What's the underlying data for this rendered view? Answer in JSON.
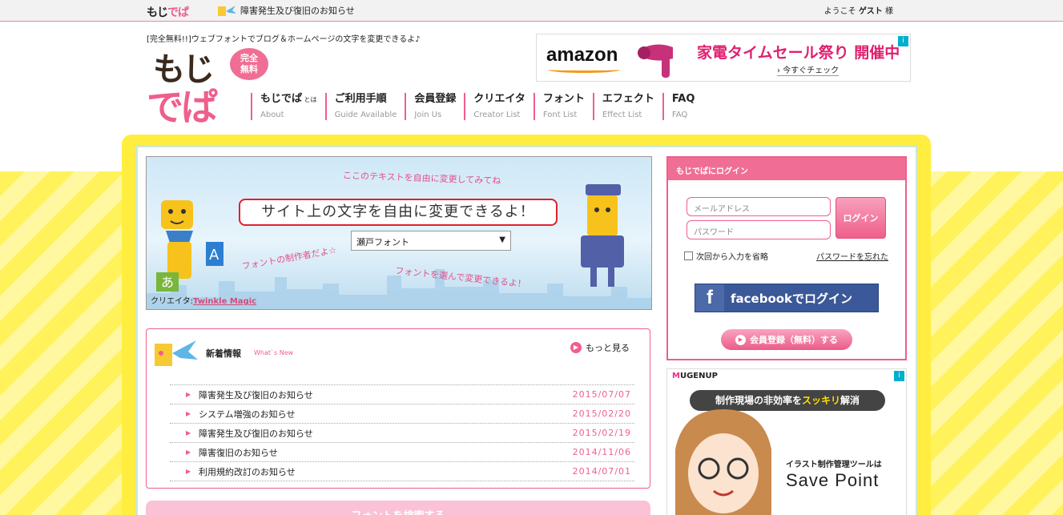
{
  "topbar": {
    "logo_a": "もじ",
    "logo_b": "でぱ",
    "notice": "障害発生及び復旧のお知らせ",
    "welcome_pre": "ようこそ",
    "welcome_name": "ゲスト",
    "welcome_post": "様"
  },
  "header": {
    "tagline": "[完全無料!!]ウェブフォントでブログ＆ホームページの文字を変更できるよ♪",
    "logo_line1": "もじ",
    "logo_line2": "でぱ",
    "badge_line1": "完全",
    "badge_line2": "無料"
  },
  "ad_top": {
    "brand": "amazon",
    "headline": "家電タイムセール祭り 開催中",
    "cta": "› 今すぐチェック",
    "ad_mark": "i"
  },
  "nav": [
    {
      "jp": "もじでぱ",
      "jp_small": " とは",
      "en": "About"
    },
    {
      "jp": "ご利用手順",
      "jp_small": "",
      "en": "Guide Available"
    },
    {
      "jp": "会員登録",
      "jp_small": "",
      "en": "Join Us"
    },
    {
      "jp": "クリエイタ",
      "jp_small": "",
      "en": "Creator List"
    },
    {
      "jp": "フォント",
      "jp_small": "",
      "en": "Font List"
    },
    {
      "jp": "エフェクト",
      "jp_small": "",
      "en": "Effect List"
    },
    {
      "jp": "FAQ",
      "jp_small": "",
      "en": "FAQ"
    }
  ],
  "hero": {
    "bubble_text": "サイト上の文字を自由に変更できるよ！",
    "font_select_value": "瀬戸フォント",
    "note_top": "ここのテキストを自由に変更してみてね",
    "note_left": "フォントの制作者だよ☆",
    "note_bottom": "フォントを選んで変更できるよ！",
    "creator_label": "クリエイタ:",
    "creator_name": "Twinkle Magic"
  },
  "news": {
    "title": "新着情報",
    "subtitle": "What`s New",
    "more": "もっと見る",
    "items": [
      {
        "text": "障害発生及び復旧のお知らせ",
        "date": "2015/07/07"
      },
      {
        "text": "システム増強のお知らせ",
        "date": "2015/02/20"
      },
      {
        "text": "障害発生及び復旧のお知らせ",
        "date": "2015/02/19"
      },
      {
        "text": "障害復旧のお知らせ",
        "date": "2014/11/06"
      },
      {
        "text": "利用規約改訂のお知らせ",
        "date": "2014/07/01"
      }
    ]
  },
  "font_search": {
    "label": "フォントを検索する"
  },
  "login": {
    "header": "もじでぱにログイン",
    "email_placeholder": "メールアドレス",
    "password_placeholder": "パスワード",
    "login_button": "ログイン",
    "remember": "次回から入力を省略",
    "forgot": "パスワードを忘れた",
    "facebook_f": "f",
    "facebook": "facebookでログイン",
    "register": "会員登録（無料）する"
  },
  "ad_side": {
    "brand_m": "M",
    "brand_rest": "UGENUP",
    "banner_pre": "制作現場の非効率を",
    "banner_hl": "スッキリ",
    "banner_post": "解消",
    "tool": "イラスト制作管理ツールは",
    "product": "Save Point",
    "ad_mark": "i"
  },
  "colors": {
    "accent_pink": "#ef5f8b",
    "yellow": "#ffee40",
    "facebook": "#3b5898"
  }
}
